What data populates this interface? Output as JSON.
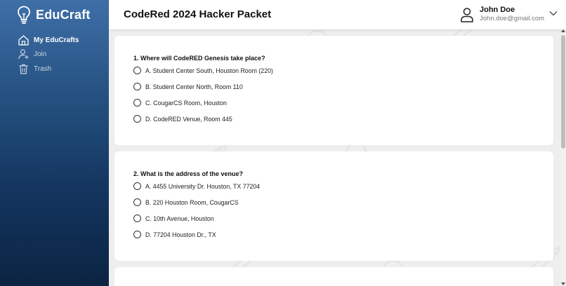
{
  "app": {
    "name": "EduCraft",
    "brand_icon": "lightbulb-icon"
  },
  "sidebar": {
    "items": [
      {
        "label": "My EduCrafts",
        "icon": "home-icon"
      },
      {
        "label": "Join",
        "icon": "add-user-icon"
      },
      {
        "label": "Trash",
        "icon": "trash-icon"
      }
    ]
  },
  "header": {
    "title": "CodeRed 2024 Hacker Packet",
    "user": {
      "name": "John Doe",
      "email": "John.doe@gmail.com"
    }
  },
  "questions": [
    {
      "text": "1. Where will CodeRED Genesis take place?",
      "options": [
        "A. Student Center South, Houston Room (220)",
        "B. Student Center North, Room 110",
        "C. CougarCS Room, Houston",
        "D. CodeRED Venue, Room 445"
      ]
    },
    {
      "text": "2. What is the address of the venue?",
      "options": [
        "A. 4455 University Dr. Houston, TX 77204",
        "B. 220 Houston Room, CougarCS",
        "C. 10th Avenue, Houston",
        "D. 77204 Houston Dr., TX"
      ]
    }
  ],
  "colors": {
    "sidebar_top": "#3f6fa8",
    "sidebar_bottom": "#0b2342",
    "card": "#ffffff",
    "page_bg": "#eeeeee"
  }
}
